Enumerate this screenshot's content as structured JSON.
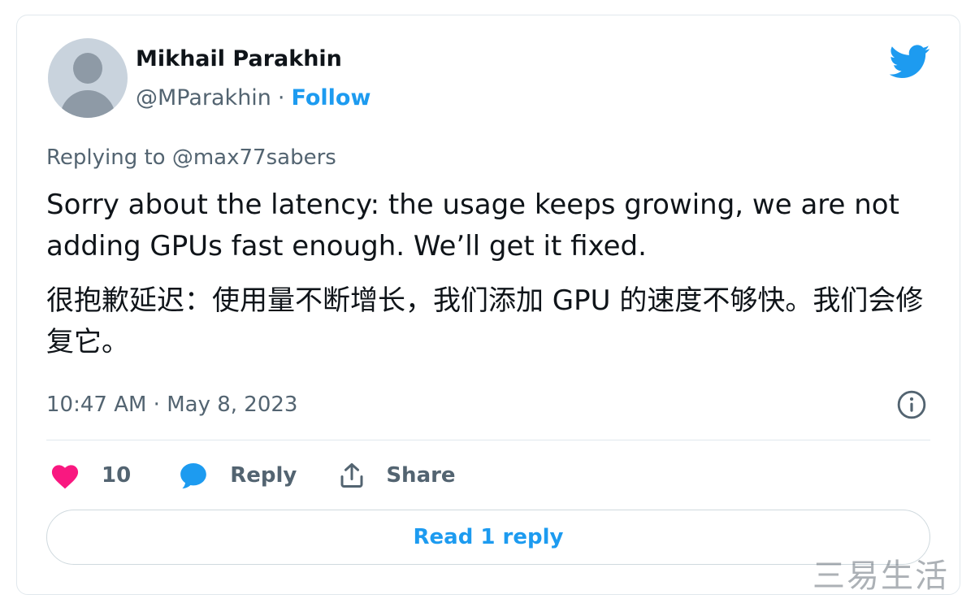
{
  "author": {
    "name": "Mikhail Parakhin",
    "handle": "@MParakhin",
    "separator": "·",
    "follow_label": "Follow"
  },
  "reply_context": {
    "prefix": "Replying to",
    "mention": "@max77sabers"
  },
  "tweet": {
    "text_en": "Sorry about the latency: the usage keeps growing, we are not adding GPUs fast enough. We’ll get it fixed.",
    "text_zh": "很抱歉延迟：使用量不断增长，我们添加 GPU 的速度不够快。我们会修复它。",
    "timestamp": "10:47 AM · May 8, 2023"
  },
  "actions": {
    "like_count": "10",
    "reply_label": "Reply",
    "share_label": "Share"
  },
  "read_replies_label": "Read 1 reply",
  "watermark": "三易生活",
  "colors": {
    "twitter_blue": "#1d9bf0",
    "like_pink": "#f91880",
    "text_primary": "#0f1419",
    "text_secondary": "#536471",
    "border": "#e1e8ed"
  },
  "icons": [
    "twitter-bird-icon",
    "info-icon",
    "heart-icon",
    "reply-bubble-icon",
    "share-icon"
  ]
}
